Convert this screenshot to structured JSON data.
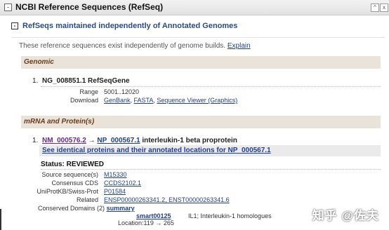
{
  "header": {
    "title": "NCBI Reference Sequences (RefSeq)",
    "toggle": "-",
    "ctl_up": "^",
    "ctl_x": "x"
  },
  "section": {
    "title": "RefSeqs maintained independently of Annotated Genomes",
    "toggle": "-"
  },
  "intro": {
    "text": "These reference sequences exist independently of genome builds.",
    "link": "Explain"
  },
  "genomic": {
    "heading": "Genomic",
    "item_num": "1.",
    "item_title": "NG_008851.1 RefSeqGene",
    "range_label": "Range",
    "range_value": "5001..12020",
    "download_label": "Download",
    "download_links": [
      "GenBank",
      "FASTA",
      "Sequence Viewer (Graphics)"
    ]
  },
  "mrna": {
    "heading": "mRNA and Protein(s)",
    "item_num": "1.",
    "nm": "NM_000576.2",
    "arrow": "→",
    "np": "NP_000567.1",
    "desc": "interleukin-1 beta proprotein",
    "identical_link": "See identical proteins and their annotated locations for NP_000567.1",
    "status": "Status: REVIEWED",
    "rows": [
      {
        "label": "Source sequence(s)",
        "value": "M15330"
      },
      {
        "label": "Consensus CDS",
        "value": "CCDS2102.1"
      },
      {
        "label": "UniProtKB/Swiss-Prot",
        "value": "P01584"
      },
      {
        "label": "Related",
        "value": "ENSP00000263341.2, ENST00000263341.6"
      }
    ],
    "conserved_label": "Conserved Domains (2)",
    "conserved_link": "summary",
    "domain_id": "smart00125",
    "domain_desc": "IL1; Interleukin-1 homologues",
    "location_label": "Location:",
    "location_value": "119 → 265"
  },
  "watermark": "知乎 @佐夫"
}
